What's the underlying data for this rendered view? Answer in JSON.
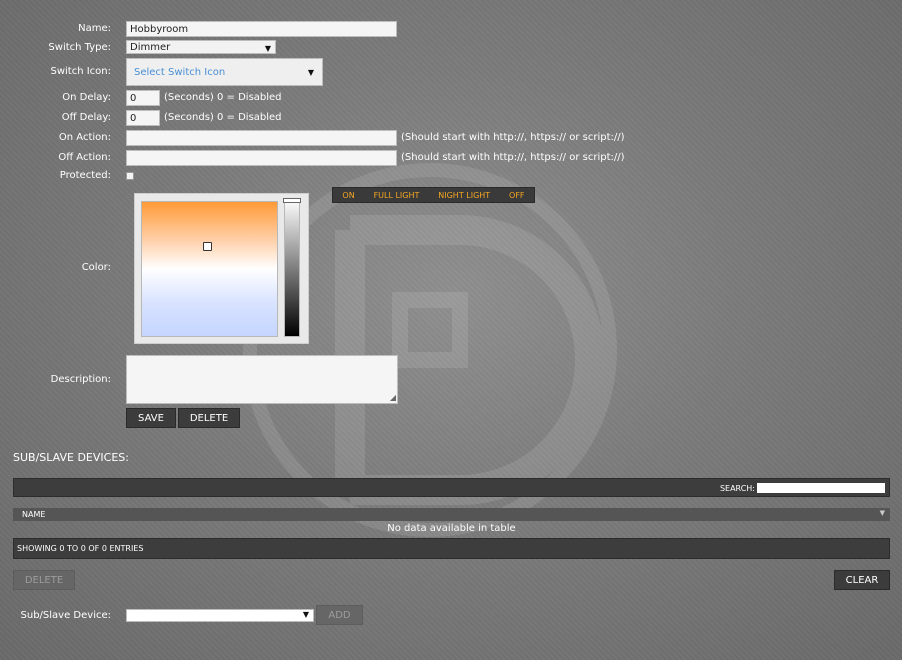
{
  "form": {
    "name_label": "Name:",
    "name_value": "Hobbyroom",
    "switch_type_label": "Switch Type:",
    "switch_type_value": "Dimmer",
    "switch_icon_label": "Switch Icon:",
    "switch_icon_value": "Select Switch Icon",
    "on_delay_label": "On Delay:",
    "on_delay_value": "0",
    "on_delay_hint": "(Seconds) 0 = Disabled",
    "off_delay_label": "Off Delay:",
    "off_delay_value": "0",
    "off_delay_hint": "(Seconds) 0 = Disabled",
    "on_action_label": "On Action:",
    "on_action_hint": "(Should start with http://, https:// or script://)",
    "off_action_label": "Off Action:",
    "off_action_hint": "(Should start with http://, https:// or script://)",
    "protected_label": "Protected:",
    "color_label": "Color:",
    "description_label": "Description:",
    "save_label": "SAVE",
    "delete_label": "DELETE"
  },
  "color_presets": [
    "ON",
    "FULL LIGHT",
    "NIGHT LIGHT",
    "OFF"
  ],
  "subslave": {
    "section_title": "SUB/SLAVE DEVICES:",
    "search_label": "SEARCH:",
    "column_name": "NAME",
    "no_data": "No data available in table",
    "info": "SHOWING 0 TO 0 OF 0 ENTRIES",
    "delete_label": "DELETE",
    "clear_label": "CLEAR",
    "device_label": "Sub/Slave Device:",
    "add_label": "ADD"
  },
  "colors": {
    "accent_orange": "#f5a623",
    "link_blue": "#4a8fd6",
    "dark_bar": "#3d3d3d"
  }
}
